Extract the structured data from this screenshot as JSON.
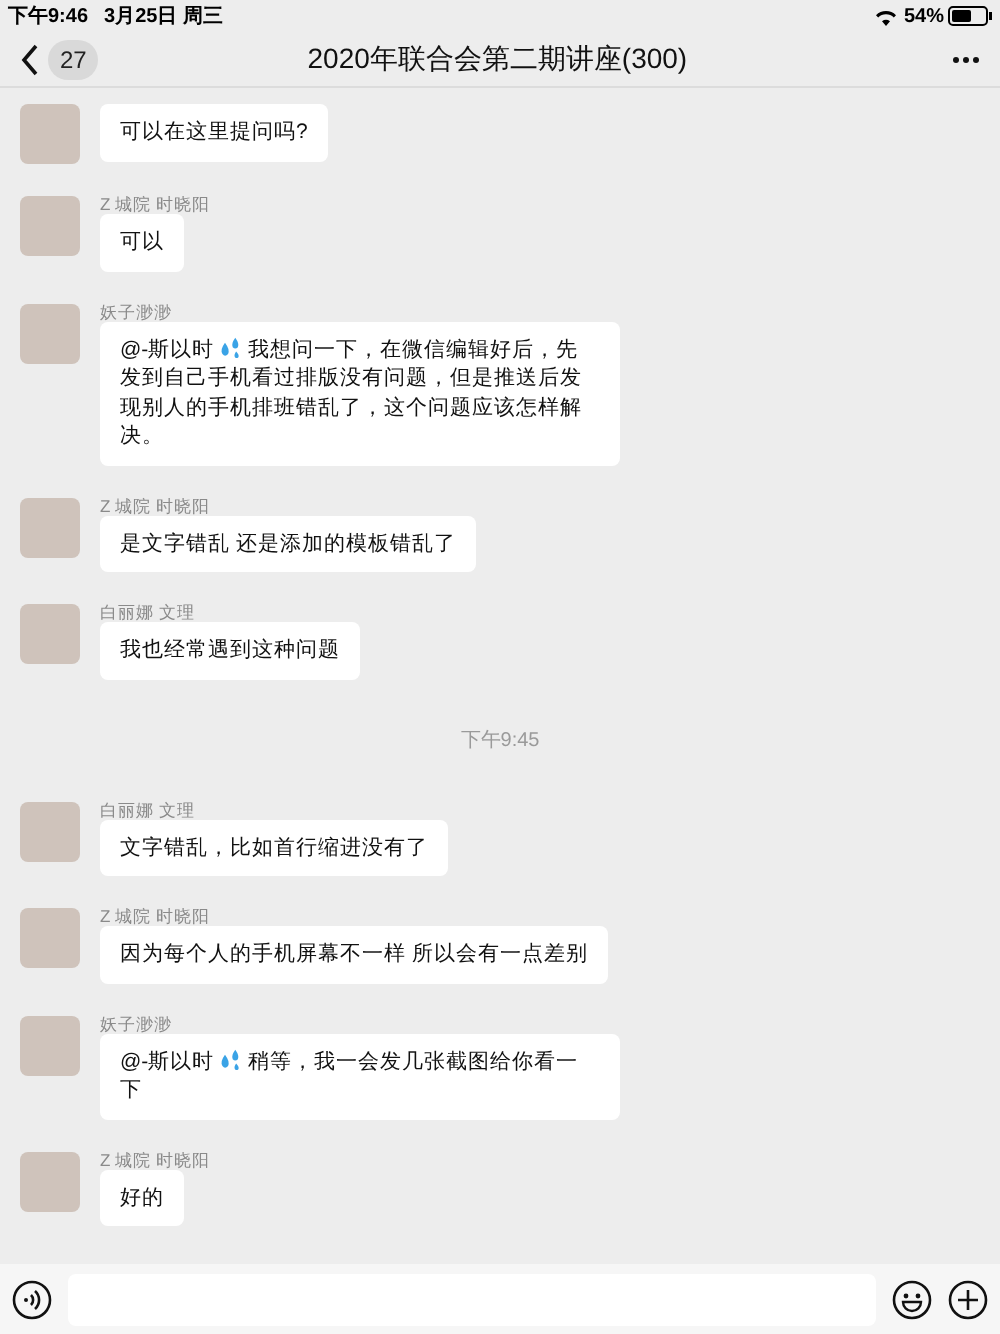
{
  "status_bar": {
    "time": "下午9:46",
    "date": "3月25日 周三",
    "battery": "54%"
  },
  "nav": {
    "unread_count": "27",
    "title": "2020年联合会第二期讲座(300)"
  },
  "messages": [
    {
      "kind": "message",
      "sweat_emoji": false,
      "text": "可以在这里提问吗?"
    },
    {
      "kind": "message",
      "sender": "Z 城院 时晓阳",
      "sweat_emoji": false,
      "text": "可以"
    },
    {
      "kind": "message",
      "sender": "妖子渺渺",
      "mention": "@-斯以时",
      "sweat_emoji": true,
      "text": "我想问一下，在微信编辑好后，先发到自己手机看过排版没有问题，但是推送后发现别人的手机排班错乱了，这个问题应该怎样解决。"
    },
    {
      "kind": "message",
      "sender": "Z 城院 时晓阳",
      "sweat_emoji": false,
      "text": "是文字错乱 还是添加的模板错乱了"
    },
    {
      "kind": "message",
      "sender": "白丽娜 文理",
      "sweat_emoji": false,
      "text": "我也经常遇到这种问题"
    },
    {
      "kind": "time",
      "text": "下午9:45"
    },
    {
      "kind": "message",
      "sender": "白丽娜 文理",
      "sweat_emoji": false,
      "text": "文字错乱，比如首行缩进没有了"
    },
    {
      "kind": "message",
      "sender": "Z 城院 时晓阳",
      "sweat_emoji": false,
      "text": "因为每个人的手机屏幕不一样  所以会有一点差别"
    },
    {
      "kind": "message",
      "sender": "妖子渺渺",
      "mention": "@-斯以时",
      "sweat_emoji": true,
      "text": "稍等，我一会发几张截图给你看一下"
    },
    {
      "kind": "message",
      "sender": "Z 城院 时晓阳",
      "sweat_emoji": false,
      "text": "好的"
    }
  ]
}
